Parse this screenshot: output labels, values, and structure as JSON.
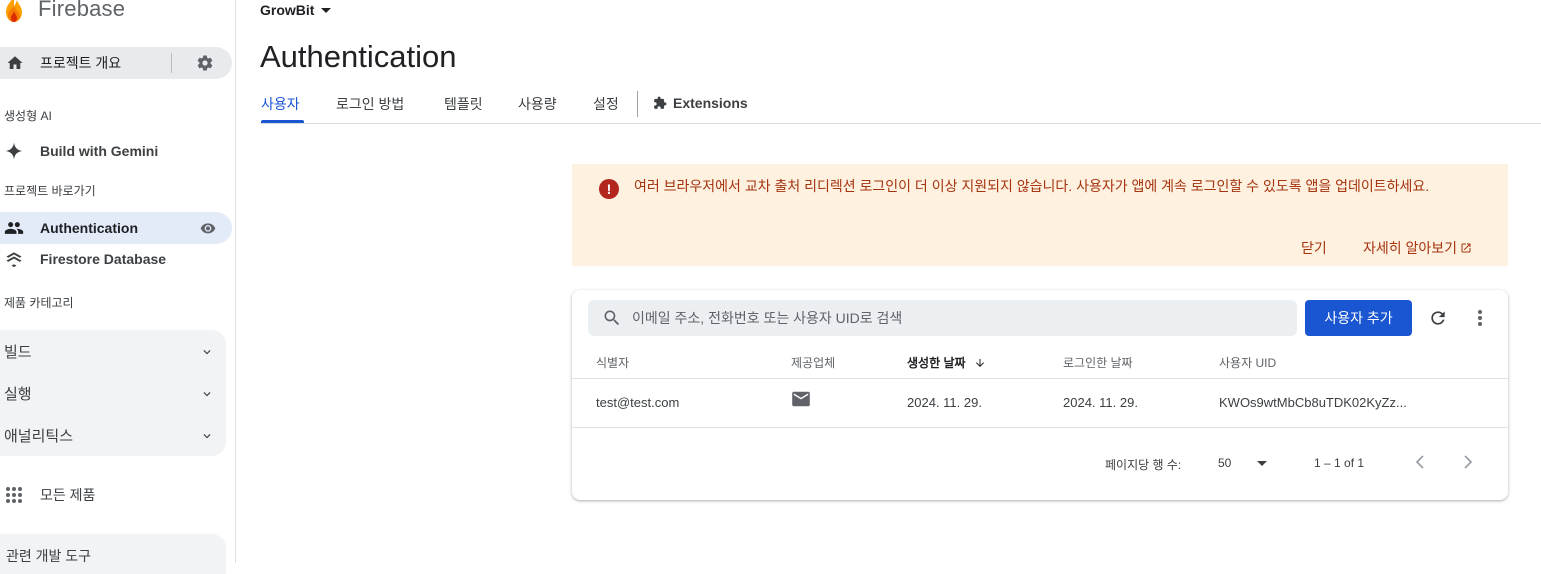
{
  "sidebar": {
    "brand": "Firebase",
    "overview_label": "프로젝트 개요",
    "section_genai": "생성형 AI",
    "build_with_gemini": "Build with Gemini",
    "section_shortcuts": "프로젝트 바로가기",
    "authentication": "Authentication",
    "firestore": "Firestore Database",
    "section_categories": "제품 카테고리",
    "categories": [
      "빌드",
      "실행",
      "애널리틱스"
    ],
    "all_products": "모든 제품",
    "dev_tools": "관련 개발 도구"
  },
  "header": {
    "project": "GrowBit",
    "title": "Authentication"
  },
  "tabs": [
    "사용자",
    "로그인 방법",
    "템플릿",
    "사용량",
    "설정"
  ],
  "extensions_tab": "Extensions",
  "banner": {
    "message": "여러 브라우저에서 교차 출처 리디렉션 로그인이 더 이상 지원되지 않습니다. 사용자가 앱에 계속 로그인할 수 있도록 앱을 업데이트하세요.",
    "close": "닫기",
    "learn_more": "자세히 알아보기"
  },
  "users_table": {
    "search_placeholder": "이메일 주소, 전화번호 또는 사용자 UID로 검색",
    "add_user": "사용자 추가",
    "columns": [
      "식별자",
      "제공업체",
      "생성한 날짜",
      "로그인한 날짜",
      "사용자 UID"
    ],
    "rows": [
      {
        "identifier": "test@test.com",
        "provider_icon": "mail-icon",
        "created": "2024. 11. 29.",
        "signed_in": "2024. 11. 29.",
        "uid": "KWOs9wtMbCb8uTDK02KyZz..."
      }
    ],
    "rows_per_page_label": "페이지당 행 수:",
    "rows_per_page": "50",
    "range": "1 – 1 of 1"
  },
  "colors": {
    "accent": "#1a56d2",
    "active_nav": "#e3eaf8",
    "banner_bg": "#fef1e0",
    "banner_text": "#a5340f",
    "error": "#b3261e"
  }
}
